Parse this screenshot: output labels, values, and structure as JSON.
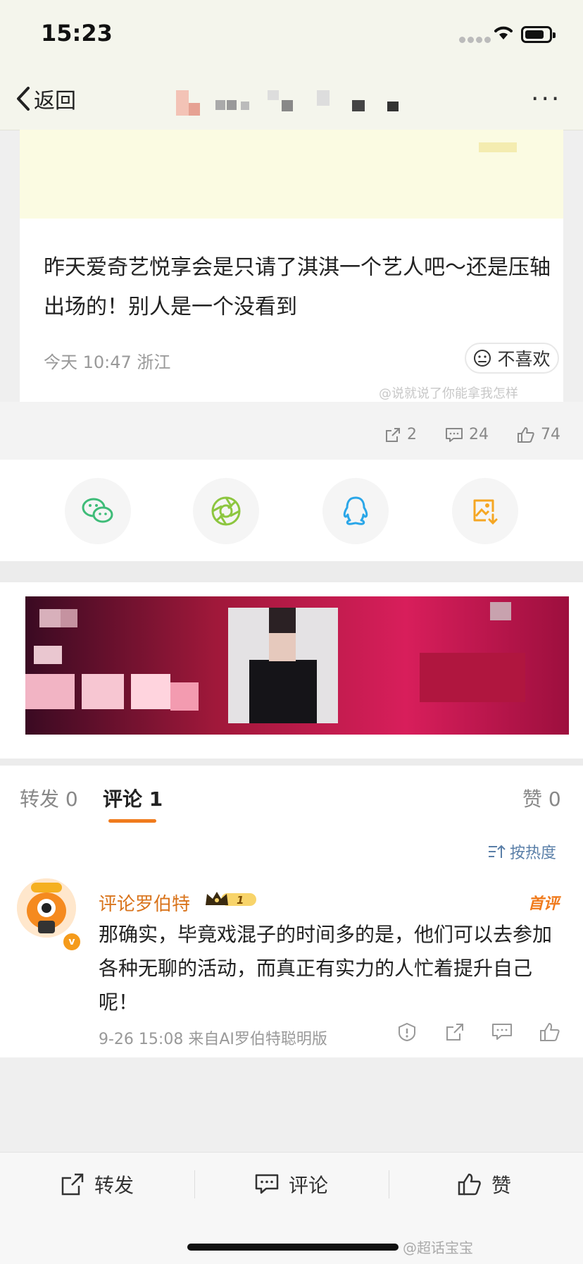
{
  "status": {
    "time": "15:23"
  },
  "nav": {
    "back_label": "返回"
  },
  "post": {
    "text": "昨天爱奇艺悦享会是只请了淇淇一个艺人吧～还是压轴出场的！别人是一个没看到",
    "meta": "今天 10:47 浙江",
    "dislike_label": "不喜欢",
    "watermark": "@说就说了你能拿我怎样"
  },
  "stats": {
    "repost": "2",
    "comment": "24",
    "like": "74"
  },
  "share": [
    "wechat-icon",
    "moments-icon",
    "qq-icon",
    "save-image-icon"
  ],
  "tabs": {
    "repost": "转发 0",
    "comment": "评论 1",
    "like": "赞 0"
  },
  "comments": {
    "sort_label": "按热度",
    "items": [
      {
        "user": "评论罗伯特",
        "badge": "首评",
        "text": "那确实，毕竟戏混子的时间多的是，他们可以去参加各种无聊的活动，而真正有实力的人忙着提升自己呢！",
        "meta": "9-26 15:08  来自AI罗伯特聪明版"
      }
    ]
  },
  "bottombar": {
    "repost": "转发",
    "comment": "评论",
    "like": "赞",
    "watermark": "@超话宝宝"
  },
  "colors": {
    "accent": "#f07b1d",
    "username": "#d9741c",
    "sort": "#5a7fa8",
    "wechat": "#3ebc78",
    "moments": "#8dc63f",
    "qq": "#2aa6e8",
    "save": "#f5a623"
  }
}
